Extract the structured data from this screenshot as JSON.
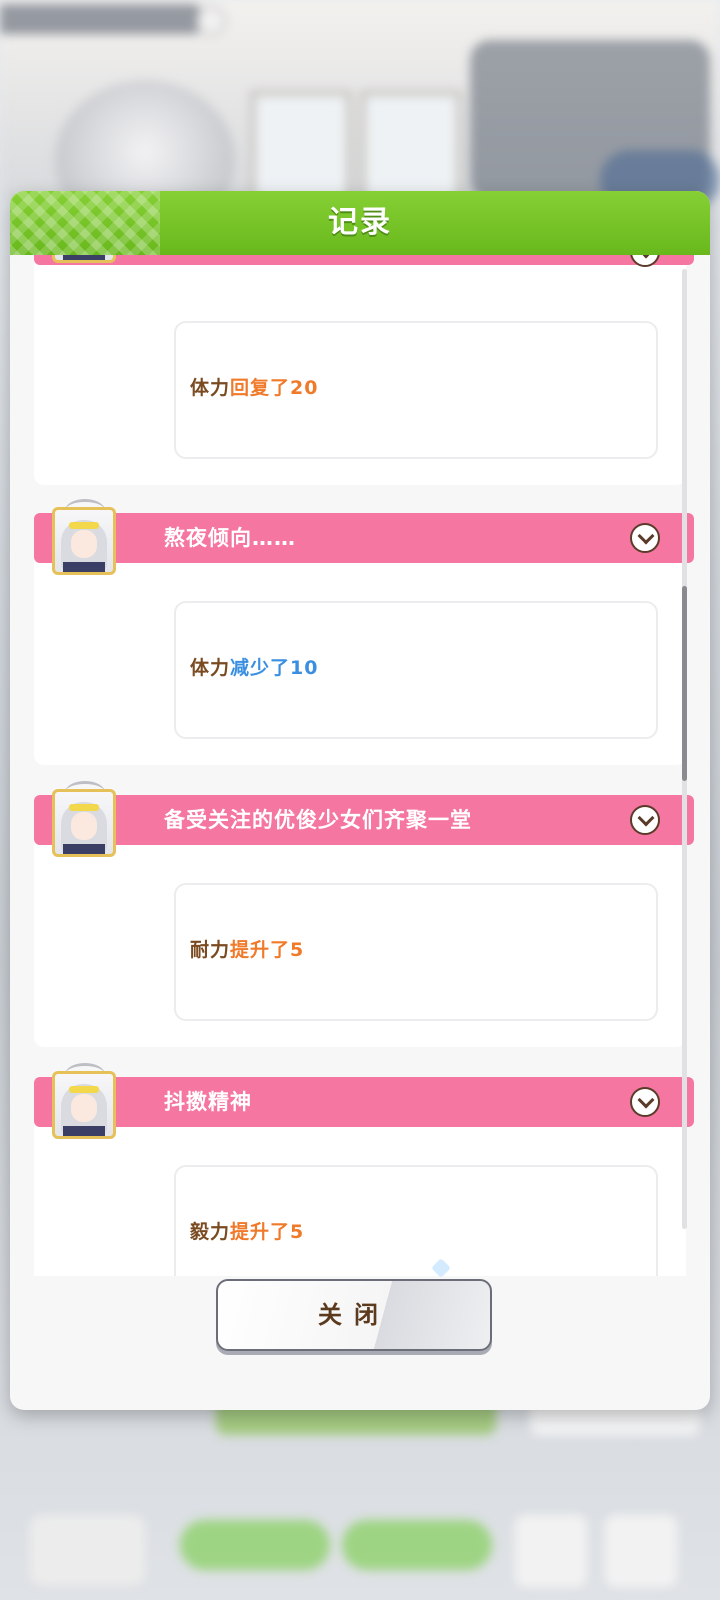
{
  "dialog": {
    "title": "记录",
    "close_label": "关闭"
  },
  "entries": [
    {
      "title": "",
      "stat": "体力",
      "change": "回复了20",
      "direction": "up"
    },
    {
      "title": "熬夜倾向……",
      "stat": "体力",
      "change": "减少了10",
      "direction": "down"
    },
    {
      "title": "备受关注的优俊少女们齐聚一堂",
      "stat": "耐力",
      "change": "提升了5",
      "direction": "up"
    },
    {
      "title": "抖擞精神",
      "stat": "毅力",
      "change": "提升了5",
      "direction": "up"
    }
  ],
  "colors": {
    "header_green": "#6fbf25",
    "entry_pink": "#f576a0",
    "increase_orange": "#f07a2a",
    "decrease_blue": "#3a8fe0",
    "stat_brown": "#7a4a21"
  },
  "icons": {
    "expand": "chevron-down-icon",
    "portrait": "character-portrait"
  }
}
